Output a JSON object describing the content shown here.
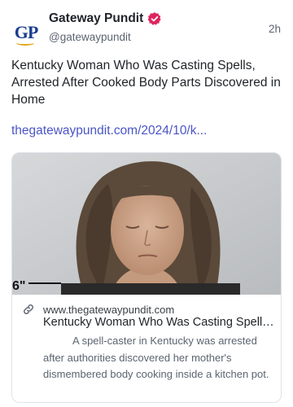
{
  "post": {
    "author_name": "Gateway Pundit",
    "author_handle": "@gatewaypundit",
    "avatar_text": "GP",
    "timestamp": "2h",
    "text": "Kentucky Woman Who Was Casting Spells, Arrested After Cooked Body Parts Discovered in Home",
    "link_text": "thegatewaypundit.com/2024/10/k..."
  },
  "card": {
    "image_caption": "6\"",
    "domain": "www.thegatewaypundit.com",
    "title": "Kentucky Woman Who Was Casting Spells, Arrested After Cooked Body Parts Discovered in Home",
    "description": "A spell-caster in Kentucky was arrested after authorities discovered her mother's dismembered body cooking inside a kitchen pot."
  },
  "colors": {
    "verified_badge": "#e0245e",
    "link": "#4a55c7",
    "brand_blue": "#1a3d8f",
    "brand_gold": "#e1a81b"
  },
  "icons": {
    "verified": "verified-badge-icon",
    "link": "link-icon"
  }
}
